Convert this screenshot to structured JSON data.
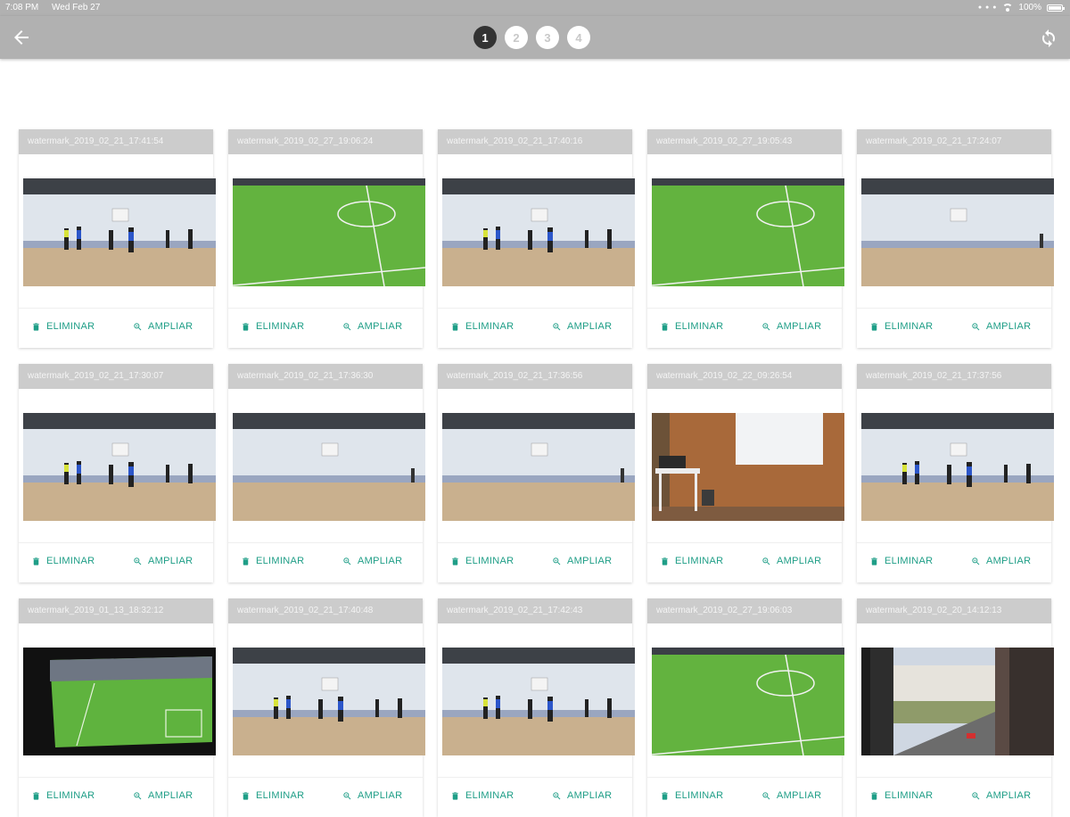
{
  "status_bar": {
    "time": "7:08 PM",
    "date": "Wed Feb 27",
    "battery_text": "100%"
  },
  "toolbar": {
    "pages": [
      "1",
      "2",
      "3",
      "4"
    ],
    "active_page": "1"
  },
  "colors": {
    "toolbar": "#b1b1b1",
    "accent": "#1f9e87",
    "active_page": "#333333"
  },
  "icons": {
    "back": "arrow-back-icon",
    "refresh": "refresh-icon",
    "delete": "trash-icon",
    "zoom": "zoom-in-icon"
  },
  "cards": [
    {
      "title": "watermark_2019_02_21_17:41:54",
      "scene": "gym-players",
      "delete_label": "ELIMINAR",
      "zoom_label": "AMPLIAR"
    },
    {
      "title": "watermark_2019_02_27_19:06:24",
      "scene": "field",
      "delete_label": "ELIMINAR",
      "zoom_label": "AMPLIAR"
    },
    {
      "title": "watermark_2019_02_21_17:40:16",
      "scene": "gym-players",
      "delete_label": "ELIMINAR",
      "zoom_label": "AMPLIAR"
    },
    {
      "title": "watermark_2019_02_27_19:05:43",
      "scene": "field",
      "delete_label": "ELIMINAR",
      "zoom_label": "AMPLIAR"
    },
    {
      "title": "watermark_2019_02_21_17:24:07",
      "scene": "gym-empty",
      "delete_label": "ELIMINAR",
      "zoom_label": "AMPLIAR"
    },
    {
      "title": "watermark_2019_02_21_17:30:07",
      "scene": "gym-players",
      "delete_label": "ELIMINAR",
      "zoom_label": "AMPLIAR"
    },
    {
      "title": "watermark_2019_02_21_17:36:30",
      "scene": "gym-empty",
      "delete_label": "ELIMINAR",
      "zoom_label": "AMPLIAR"
    },
    {
      "title": "watermark_2019_02_21_17:36:56",
      "scene": "gym-empty",
      "delete_label": "ELIMINAR",
      "zoom_label": "AMPLIAR"
    },
    {
      "title": "watermark_2019_02_22_09:26:54",
      "scene": "room",
      "delete_label": "ELIMINAR",
      "zoom_label": "AMPLIAR"
    },
    {
      "title": "watermark_2019_02_21_17:37:56",
      "scene": "gym-players",
      "delete_label": "ELIMINAR",
      "zoom_label": "AMPLIAR"
    },
    {
      "title": "watermark_2019_01_13_18:32:12",
      "scene": "tv",
      "delete_label": "ELIMINAR",
      "zoom_label": "AMPLIAR"
    },
    {
      "title": "watermark_2019_02_21_17:40:48",
      "scene": "gym-players",
      "delete_label": "ELIMINAR",
      "zoom_label": "AMPLIAR"
    },
    {
      "title": "watermark_2019_02_21_17:42:43",
      "scene": "gym-players",
      "delete_label": "ELIMINAR",
      "zoom_label": "AMPLIAR"
    },
    {
      "title": "watermark_2019_02_27_19:06:03",
      "scene": "field",
      "delete_label": "ELIMINAR",
      "zoom_label": "AMPLIAR"
    },
    {
      "title": "watermark_2019_02_20_14:12:13",
      "scene": "window",
      "delete_label": "ELIMINAR",
      "zoom_label": "AMPLIAR"
    }
  ]
}
